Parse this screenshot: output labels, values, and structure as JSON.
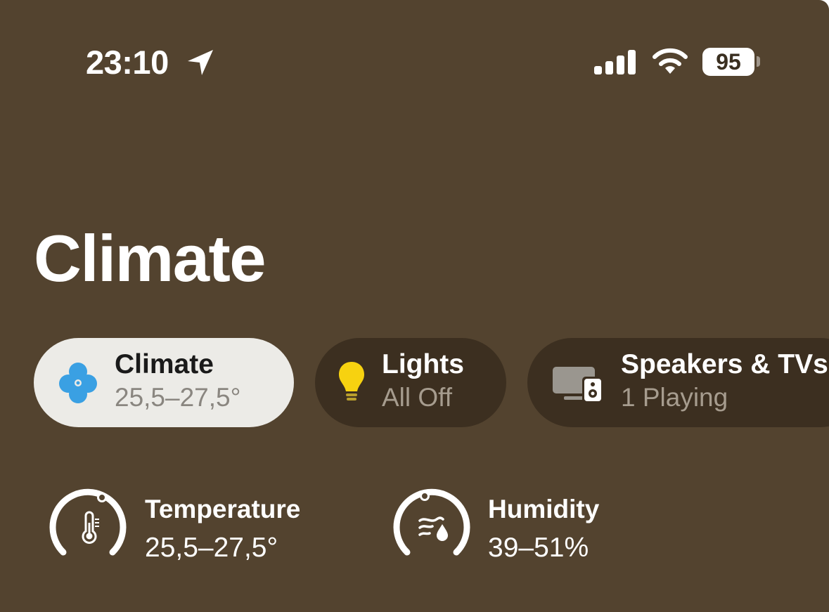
{
  "status_bar": {
    "time": "23:10",
    "location_icon": "location-arrow-icon",
    "signal_icon": "cellular-signal-icon",
    "wifi_icon": "wifi-icon",
    "battery_percent": "95"
  },
  "page": {
    "title": "Climate"
  },
  "categories": [
    {
      "title": "Climate",
      "subtitle": "25,5–27,5°",
      "icon": "fan-icon",
      "selected": true
    },
    {
      "title": "Lights",
      "subtitle": "All Off",
      "icon": "lightbulb-icon",
      "selected": false
    },
    {
      "title": "Speakers & TVs",
      "subtitle": "1 Playing",
      "icon": "tv-speaker-icon",
      "selected": false
    }
  ],
  "sensors": [
    {
      "title": "Temperature",
      "value": "25,5–27,5°",
      "icon": "thermometer-icon"
    },
    {
      "title": "Humidity",
      "value": "39–51%",
      "icon": "humidity-icon"
    }
  ],
  "colors": {
    "background": "#53432f",
    "pill_selected": "#ecebe7",
    "pill_unselected": "#3c2f20",
    "fan_blue": "#3aa0e3",
    "bulb_yellow": "#f7d210"
  }
}
